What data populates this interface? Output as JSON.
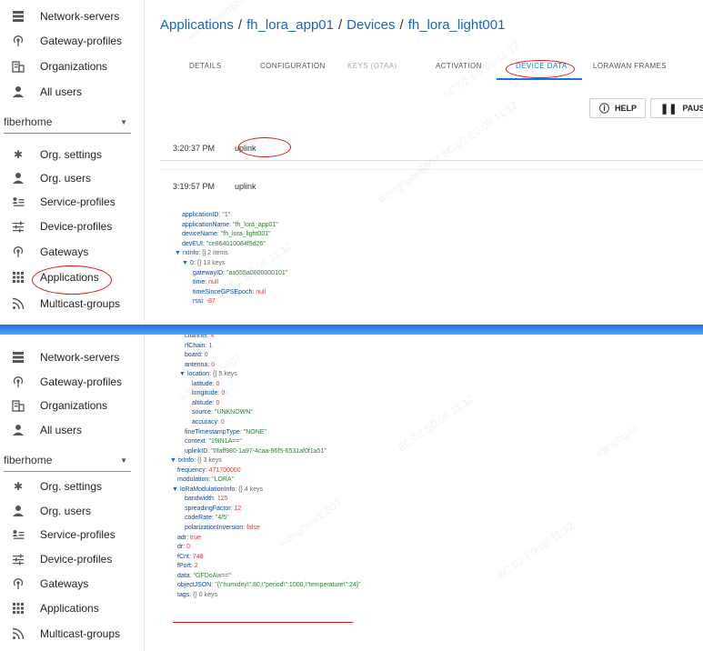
{
  "nav_top": [
    "Network-servers",
    "Gateway-profiles",
    "Organizations",
    "All users"
  ],
  "org_select": {
    "value": "fiberhome"
  },
  "nav_org": [
    "Org. settings",
    "Org. users",
    "Service-profiles",
    "Device-profiles",
    "Gateways",
    "Applications",
    "Multicast-groups"
  ],
  "breadcrumb": [
    "Applications",
    "fh_lora_app01",
    "Devices",
    "fh_lora_light001"
  ],
  "tabs": [
    "DETAILS",
    "CONFIGURATION",
    "KEYS (OTAA)",
    "ACTIVATION",
    "DEVICE DATA",
    "LORAWAN FRAMES",
    "F"
  ],
  "buttons": {
    "help": "HELP",
    "pause": "PAUS"
  },
  "events": [
    {
      "time": "3:20:37 PM",
      "type": "uplink"
    },
    {
      "time": "3:19:57 PM",
      "type": "uplink"
    }
  ],
  "json_top": [
    {
      "k": "applicationID",
      "v": "\"1\"",
      "c": "s"
    },
    {
      "k": "applicationName",
      "v": "\"fh_lora_app01\"",
      "c": "s"
    },
    {
      "k": "deviceName",
      "v": "\"fh_lora_light001\"",
      "c": "s"
    },
    {
      "k": "devEUI",
      "v": "\"ce864010084f5d26\"",
      "c": "s"
    },
    {
      "k": "rxInfo",
      "v": "[] 2 items",
      "c": "m",
      "tri": true
    },
    {
      "k": "0",
      "v": "{} 13 keys",
      "c": "m",
      "tri": true
    },
    {
      "k": "gatewayID",
      "v": "\"aa555a0000000101\"",
      "c": "s"
    },
    {
      "k": "time",
      "v": "null",
      "c": "n"
    },
    {
      "k": "timeSinceGPSEpoch",
      "v": "null",
      "c": "n"
    },
    {
      "k": "rssi",
      "v": "-87",
      "c": "n"
    }
  ],
  "json_bottom": [
    {
      "k": "channel",
      "v": "4",
      "c": "n"
    },
    {
      "k": "rfChain",
      "v": "1",
      "c": "n"
    },
    {
      "k": "board",
      "v": "0",
      "c": "n"
    },
    {
      "k": "antenna",
      "v": "0",
      "c": "n"
    },
    {
      "k": "location",
      "v": "{} 5 keys",
      "c": "m",
      "tri": true
    },
    {
      "k": "latitude",
      "v": "0",
      "c": "n"
    },
    {
      "k": "longitude",
      "v": "0",
      "c": "n"
    },
    {
      "k": "altitude",
      "v": "0",
      "c": "n"
    },
    {
      "k": "source",
      "v": "\"UNKNOWN\"",
      "c": "s"
    },
    {
      "k": "accuracy",
      "v": "0",
      "c": "n"
    },
    {
      "k": "fineTimestampType",
      "v": "\"NONE\"",
      "c": "s"
    },
    {
      "k": "context",
      "v": "\"19IN1A==\"",
      "c": "s"
    },
    {
      "k": "uplinkID",
      "v": "\"0faff980-1a97-4caa-96f5-6531af0f1a51\"",
      "c": "s"
    },
    {
      "k": "txInfo",
      "v": "{} 3 keys",
      "c": "m",
      "tri": true
    },
    {
      "k": "frequency",
      "v": "471700000",
      "c": "n"
    },
    {
      "k": "modulation",
      "v": "\"LORA\"",
      "c": "s"
    },
    {
      "k": "loRaModulationInfo",
      "v": "{} 4 keys",
      "c": "m",
      "tri": true
    },
    {
      "k": "bandwidth",
      "v": "125",
      "c": "n"
    },
    {
      "k": "spreadingFactor",
      "v": "12",
      "c": "n"
    },
    {
      "k": "codeRate",
      "v": "\"4/5\"",
      "c": "s"
    },
    {
      "k": "polarizationInversion",
      "v": "false",
      "c": "n"
    },
    {
      "k": "adr",
      "v": "true",
      "c": "n"
    },
    {
      "k": "dr",
      "v": "0",
      "c": "n"
    },
    {
      "k": "fCnt",
      "v": "748",
      "c": "n"
    },
    {
      "k": "fPort",
      "v": "2",
      "c": "n"
    },
    {
      "k": "data",
      "v": "\"GFDoAw==\"",
      "c": "s"
    },
    {
      "k": "objectJSON",
      "v": "\"{\\\"humidity\\\":80,\\\"period\\\":1000,\\\"temperature\\\":24}\"",
      "c": "s"
    },
    {
      "k": "tags",
      "v": "{} 0 keys",
      "c": "m"
    }
  ],
  "colors": {
    "link": "#1565c0",
    "accent": "#1976d2",
    "annotation": "#dd1111"
  }
}
